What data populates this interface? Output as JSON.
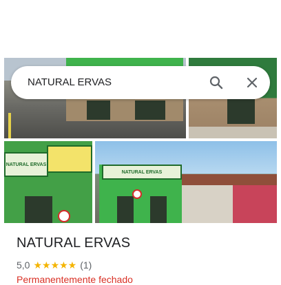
{
  "search": {
    "query": "NATURAL ERVAS",
    "search_icon": "search-icon",
    "close_icon": "close-icon"
  },
  "place": {
    "name": "NATURAL ERVAS",
    "rating_value": "5,0",
    "stars": "★★★★★",
    "review_count": "(1)",
    "status": "Permanentemente fechado"
  },
  "photo_signs": {
    "sign_a": "NATURAL ERVAS",
    "sign_b": "NATURAL ERVAS"
  },
  "colors": {
    "star": "#f4b400",
    "status_closed": "#d93025",
    "storefront_green": "#3fb34c"
  }
}
